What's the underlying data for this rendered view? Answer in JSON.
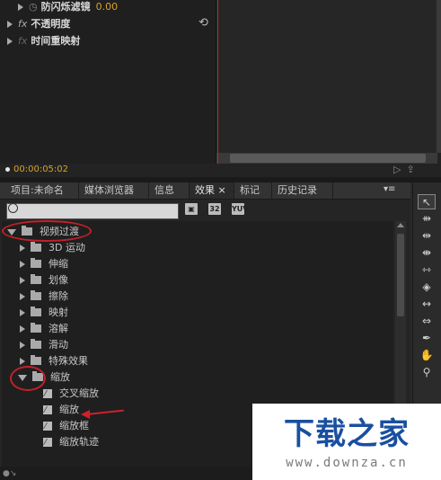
{
  "effect_controls": {
    "rows": [
      {
        "label": "防闪烁滤镜",
        "value": "0.00",
        "fx": false
      },
      {
        "label": "不透明度",
        "fx": true
      },
      {
        "label": "时间重映射",
        "fx": true
      }
    ],
    "timecode": "00:00:05:02"
  },
  "tabs": [
    {
      "label": "项目:未命名"
    },
    {
      "label": "媒体浏览器"
    },
    {
      "label": "信息"
    },
    {
      "label": "效果 ×"
    },
    {
      "label": "标记"
    },
    {
      "label": "历史记录"
    }
  ],
  "panel_menu": "▾≡",
  "search": {
    "placeholder": ""
  },
  "tool_buttons": [
    "▣",
    "32",
    "YUV"
  ],
  "effects_tree": [
    {
      "label": "视频过渡",
      "type": "folder",
      "expanded": true,
      "level": 0
    },
    {
      "label": "3D 运动",
      "type": "folder",
      "expanded": false,
      "level": 1
    },
    {
      "label": "伸缩",
      "type": "folder",
      "expanded": false,
      "level": 1
    },
    {
      "label": "划像",
      "type": "folder",
      "expanded": false,
      "level": 1
    },
    {
      "label": "擦除",
      "type": "folder",
      "expanded": false,
      "level": 1
    },
    {
      "label": "映射",
      "type": "folder",
      "expanded": false,
      "level": 1
    },
    {
      "label": "溶解",
      "type": "folder",
      "expanded": false,
      "level": 1
    },
    {
      "label": "滑动",
      "type": "folder",
      "expanded": false,
      "level": 1
    },
    {
      "label": "特殊效果",
      "type": "folder",
      "expanded": false,
      "level": 1
    },
    {
      "label": "缩放",
      "type": "folder",
      "expanded": true,
      "level": 1
    },
    {
      "label": "交叉缩放",
      "type": "preset",
      "level": 2
    },
    {
      "label": "缩放",
      "type": "preset",
      "level": 2
    },
    {
      "label": "缩放框",
      "type": "preset",
      "level": 2
    },
    {
      "label": "缩放轨迹",
      "type": "preset",
      "level": 2
    }
  ],
  "tools": [
    "selection-tool",
    "track-select-tool",
    "ripple-edit-tool",
    "rolling-edit-tool",
    "rate-stretch-tool",
    "razor-tool",
    "slip-tool",
    "slide-tool",
    "pen-tool",
    "hand-tool",
    "zoom-tool"
  ],
  "watermark": {
    "title": "下载之家",
    "url": "www.downza.cn"
  },
  "colors": {
    "accent_orange": "#d8a228",
    "annotation_red": "#c3202a",
    "watermark_blue": "#1a4fa0"
  }
}
